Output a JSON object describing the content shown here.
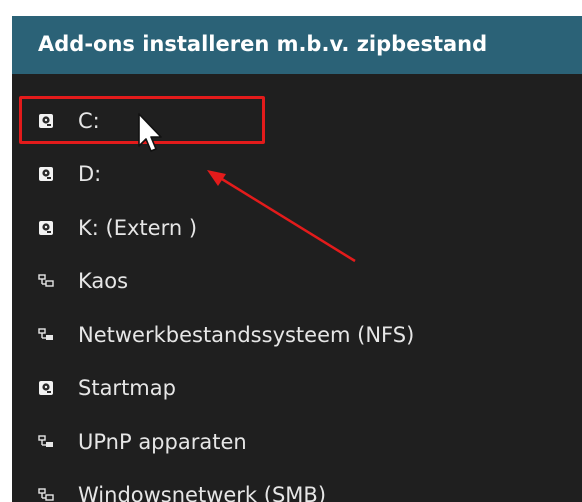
{
  "dialog": {
    "title": "Add-ons installeren m.b.v. zipbestand"
  },
  "list": {
    "items": [
      {
        "label": "C:",
        "icon": "hard-drive-icon"
      },
      {
        "label": "D:",
        "icon": "hard-drive-icon"
      },
      {
        "label": "K: (Extern )",
        "icon": "hard-drive-icon"
      },
      {
        "label": "Kaos",
        "icon": "network-icon"
      },
      {
        "label": "Netwerkbestandssysteem (NFS)",
        "icon": "network-icon"
      },
      {
        "label": "Startmap",
        "icon": "hard-drive-icon"
      },
      {
        "label": "UPnP apparaten",
        "icon": "network-icon"
      },
      {
        "label": "Windowsnetwerk (SMB)",
        "icon": "network-icon"
      }
    ]
  },
  "annotations": {
    "highlight_color": "#e31b1b",
    "arrow_color": "#e31b1b"
  },
  "colors": {
    "header": "#2b6277",
    "background": "#1f1f1f",
    "text": "#e6e6e6"
  }
}
